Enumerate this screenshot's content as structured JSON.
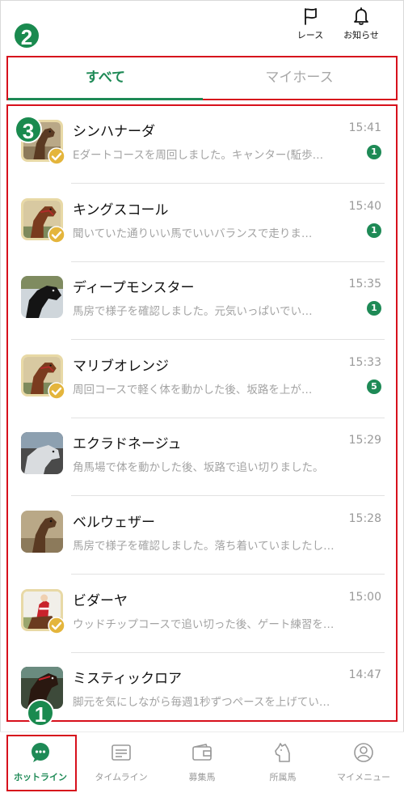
{
  "header": {
    "race_label": "レース",
    "notice_label": "お知らせ"
  },
  "callouts": {
    "one": "1",
    "two": "2",
    "three": "3"
  },
  "tabs": {
    "all": "すべて",
    "my_horse": "マイホース"
  },
  "colors": {
    "accent": "#1e8a56",
    "highlight": "#d7101c",
    "badge_gold": "#e8d9a6"
  },
  "messages": [
    {
      "name": "シンハナーダ",
      "time": "15:41",
      "preview": "Eダートコースを周回しました。キャンター(駈歩…",
      "count": "1",
      "thumb": "horse-bay",
      "verified": true
    },
    {
      "name": "キングスコール",
      "time": "15:40",
      "preview": "聞いていた通りいい馬でいいバランスで走りま…",
      "count": "1",
      "thumb": "horse-chestnut",
      "verified": true
    },
    {
      "name": "ディープモンスター",
      "time": "15:35",
      "preview": "馬房で様子を確認しました。元気いっぱいでい…",
      "count": "1",
      "thumb": "horse-black",
      "verified": false
    },
    {
      "name": "マリブオレンジ",
      "time": "15:33",
      "preview": "周回コースで軽く体を動かした後、坂路を上が…",
      "count": "5",
      "thumb": "horse-chestnut",
      "verified": true
    },
    {
      "name": "エクラドネージュ",
      "time": "15:29",
      "preview": "角馬場で体を動かした後、坂路で追い切りました。",
      "count": "",
      "thumb": "horse-grey",
      "verified": false
    },
    {
      "name": "ベルウェザー",
      "time": "15:28",
      "preview": "馬房で様子を確認しました。落ち着いていましたし…",
      "count": "",
      "thumb": "horse-bay",
      "verified": false
    },
    {
      "name": "ビダーヤ",
      "time": "15:00",
      "preview": "ウッドチップコースで追い切った後、ゲート練習を…",
      "count": "",
      "thumb": "jockey-red",
      "verified": true
    },
    {
      "name": "ミスティックロア",
      "time": "14:47",
      "preview": "脚元を気にしながら毎週1秒ずつペースを上げてい…",
      "count": "",
      "thumb": "horse-dark",
      "verified": false
    }
  ],
  "nav": {
    "hot_line": "ホットライン",
    "timeline": "タイムライン",
    "recruit": "募集馬",
    "owned": "所属馬",
    "my_menu": "マイメニュー"
  }
}
